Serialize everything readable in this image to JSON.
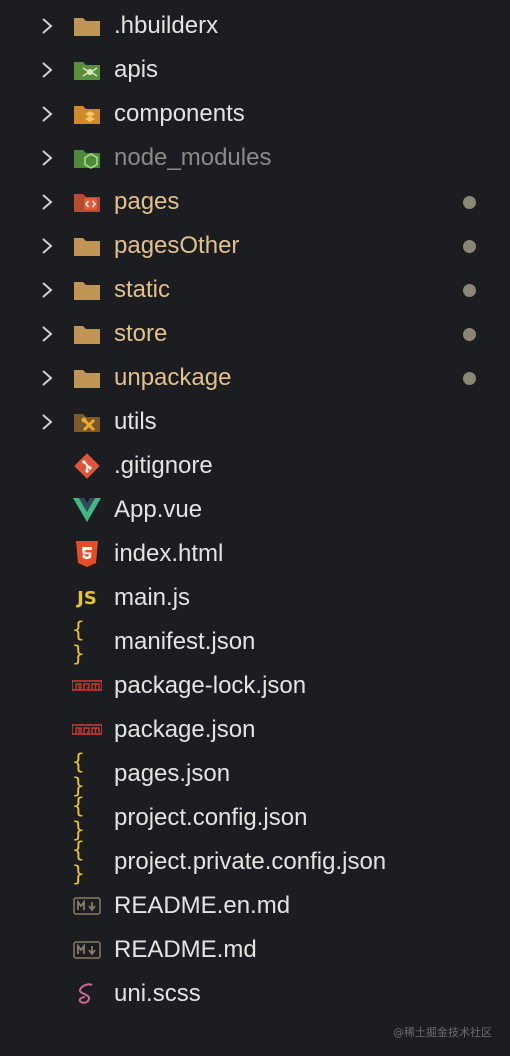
{
  "explorer": {
    "folders": [
      {
        "name": ".hbuilderx",
        "icon": "folder-icon",
        "state": "normal",
        "dot": false
      },
      {
        "name": "apis",
        "icon": "api-folder-icon",
        "state": "normal",
        "dot": false
      },
      {
        "name": "components",
        "icon": "components-folder-icon",
        "state": "normal",
        "dot": false
      },
      {
        "name": "node_modules",
        "icon": "node-folder-icon",
        "state": "ignored",
        "dot": false
      },
      {
        "name": "pages",
        "icon": "pages-folder-icon",
        "state": "modified",
        "dot": true
      },
      {
        "name": "pagesOther",
        "icon": "folder-icon",
        "state": "modified",
        "dot": true
      },
      {
        "name": "static",
        "icon": "folder-icon",
        "state": "modified",
        "dot": true
      },
      {
        "name": "store",
        "icon": "folder-icon",
        "state": "modified",
        "dot": true
      },
      {
        "name": "unpackage",
        "icon": "folder-icon",
        "state": "modified",
        "dot": true
      },
      {
        "name": "utils",
        "icon": "utils-folder-icon",
        "state": "normal",
        "dot": false
      }
    ],
    "files": [
      {
        "name": ".gitignore",
        "icon": "git-icon"
      },
      {
        "name": "App.vue",
        "icon": "vue-icon"
      },
      {
        "name": "index.html",
        "icon": "html5-icon"
      },
      {
        "name": "main.js",
        "icon": "js-icon",
        "glyph": "JS"
      },
      {
        "name": "manifest.json",
        "icon": "json-icon",
        "glyph": "{ }"
      },
      {
        "name": "package-lock.json",
        "icon": "npm-icon"
      },
      {
        "name": "package.json",
        "icon": "npm-icon"
      },
      {
        "name": "pages.json",
        "icon": "json-icon",
        "glyph": "{ }"
      },
      {
        "name": "project.config.json",
        "icon": "json-icon",
        "glyph": "{ }"
      },
      {
        "name": "project.private.config.json",
        "icon": "json-icon",
        "glyph": "{ }"
      },
      {
        "name": "README.en.md",
        "icon": "markdown-icon"
      },
      {
        "name": "README.md",
        "icon": "markdown-icon"
      },
      {
        "name": "uni.scss",
        "icon": "sass-icon"
      }
    ]
  },
  "watermark": "@稀土掘金技术社区",
  "colors": {
    "background": "#1c1d21",
    "modified": "#e2c08d",
    "ignored": "#8a8a8a",
    "text": "#e3e3e3",
    "folder": "#c09553",
    "json": "#e6c234"
  }
}
